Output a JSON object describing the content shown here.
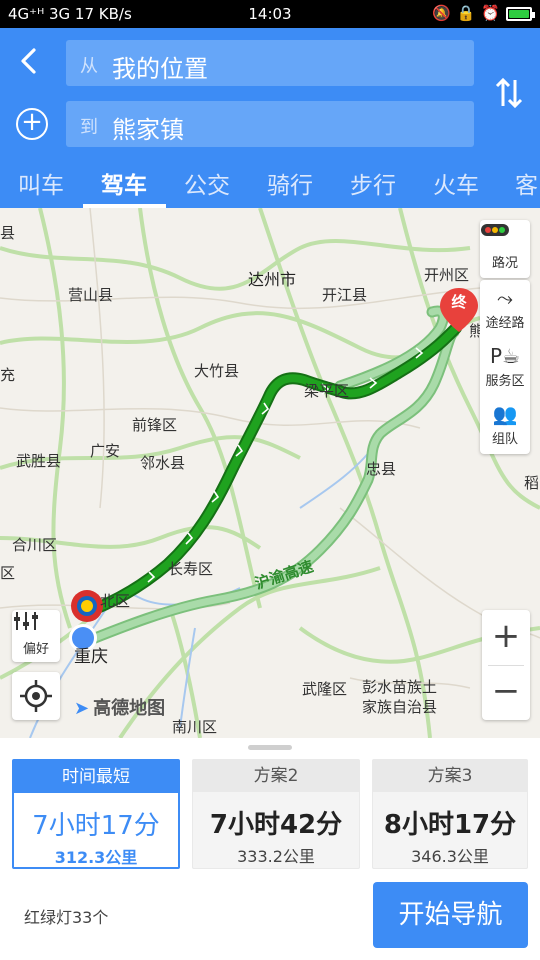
{
  "status_bar": {
    "signal": "4G⁺ᴴ 3G",
    "speed": "17 KB/s",
    "time": "14:03"
  },
  "search": {
    "from_label": "从",
    "from_value": "我的位置",
    "to_label": "到",
    "to_value": "熊家镇"
  },
  "tabs": [
    "叫车",
    "驾车",
    "公交",
    "骑行",
    "步行",
    "火车",
    "客"
  ],
  "active_tab": "驾车",
  "map": {
    "places": {
      "dazhou": "达州市",
      "yingshan": "营山县",
      "kaijiang": "开江县",
      "kaizhou": "开州区",
      "dazhu": "大竹县",
      "liangping": "梁平区",
      "qianfeng": "前锋区",
      "guangan": "广安",
      "linshui": "邻水县",
      "wusheng": "武胜县",
      "zhongxian": "忠县",
      "hechuan": "合川区",
      "changshou": "长寿区",
      "yubei": "北区",
      "chongqing": "重庆",
      "wulong": "武隆区",
      "pengshui1": "彭水苗族土",
      "pengshui2": "家族自治县",
      "nanchuan": "南川区",
      "road_name": "沪渝高速",
      "left_edge_1": "县",
      "left_edge_2": "充",
      "left_edge_3": "区",
      "right_edge": "稻",
      "xiong_edge": "熊"
    },
    "end_marker": "终",
    "logo": "高德地图",
    "controls": {
      "traffic": "路况",
      "waypoint": "途经路",
      "service": "服务区",
      "team": "组队",
      "preference": "偏好",
      "zoom_in": "+",
      "zoom_out": "−"
    }
  },
  "plans": [
    {
      "head": "时间最短",
      "duration": "7小时17分",
      "distance": "312.3公里",
      "selected": true
    },
    {
      "head": "方案2",
      "duration": "7小时42分",
      "distance": "333.2公里",
      "selected": false
    },
    {
      "head": "方案3",
      "duration": "8小时17分",
      "distance": "346.3公里",
      "selected": false
    }
  ],
  "traffic_lights": "红绿灯33个",
  "start_nav": "开始导航",
  "colors": {
    "primary": "#3d8cf5",
    "route_main": "#1fa21f",
    "route_alt": "#9fd49f",
    "end_marker": "#e8413c"
  }
}
